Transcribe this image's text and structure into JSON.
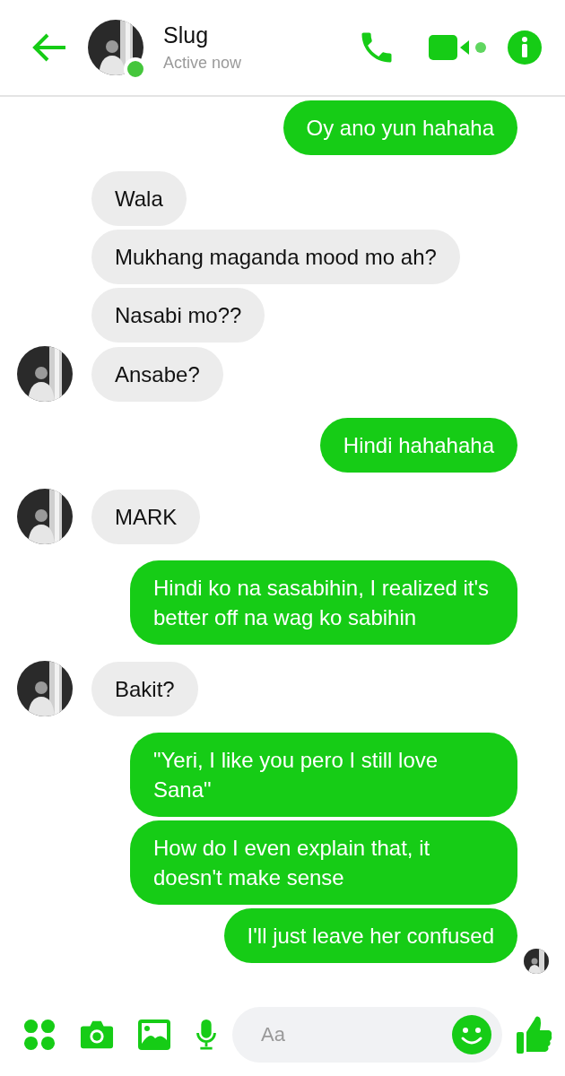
{
  "header": {
    "name": "Slug",
    "status": "Active now",
    "online": true
  },
  "groups": [
    {
      "kind": "sent",
      "messages": [
        {
          "text": "Oy ano yun hahaha"
        }
      ]
    },
    {
      "kind": "received",
      "avatar": true,
      "messages": [
        {
          "text": "Wala"
        },
        {
          "text": "Mukhang maganda mood mo ah?"
        },
        {
          "text": "Nasabi mo??"
        },
        {
          "text": "Ansabe?"
        }
      ]
    },
    {
      "kind": "sent",
      "messages": [
        {
          "text": "Hindi hahahaha"
        }
      ]
    },
    {
      "kind": "received",
      "avatar": true,
      "messages": [
        {
          "text": "MARK"
        }
      ]
    },
    {
      "kind": "sent",
      "messages": [
        {
          "text": "Hindi ko na sasabihin, I realized it's better off na wag ko sabihin"
        }
      ]
    },
    {
      "kind": "received",
      "avatar": true,
      "messages": [
        {
          "text": "Bakit?"
        }
      ]
    },
    {
      "kind": "sent",
      "seen": true,
      "messages": [
        {
          "text": "\"Yeri, I like you pero I still love Sana\""
        },
        {
          "text": "How do I even explain that, it doesn't make sense"
        },
        {
          "text": "I'll just leave her confused"
        }
      ]
    }
  ],
  "composer": {
    "placeholder": "Aa"
  }
}
